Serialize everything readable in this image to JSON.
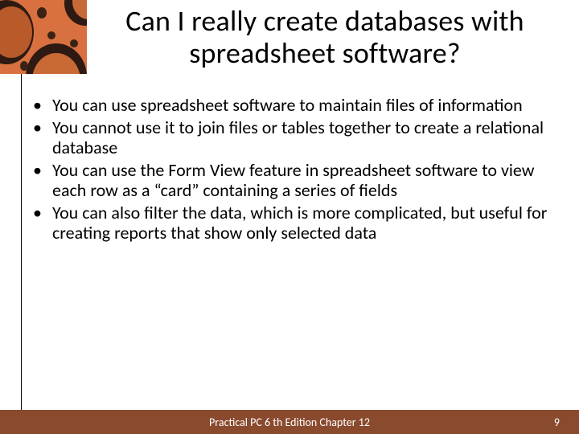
{
  "title": "Can I really create databases with spreadsheet software?",
  "bullets": [
    "You can use spreadsheet software to maintain files of information",
    "You cannot use it to join files or tables together to create a relational database",
    "You can use the Form View feature in spreadsheet software to view each row as a “card” containing a series of fields",
    "You can also filter the data, which is more complicated, but useful for creating reports that show only selected data"
  ],
  "footer": {
    "text": "Practical PC 6 th Edition Chapter 12",
    "page": "9"
  }
}
